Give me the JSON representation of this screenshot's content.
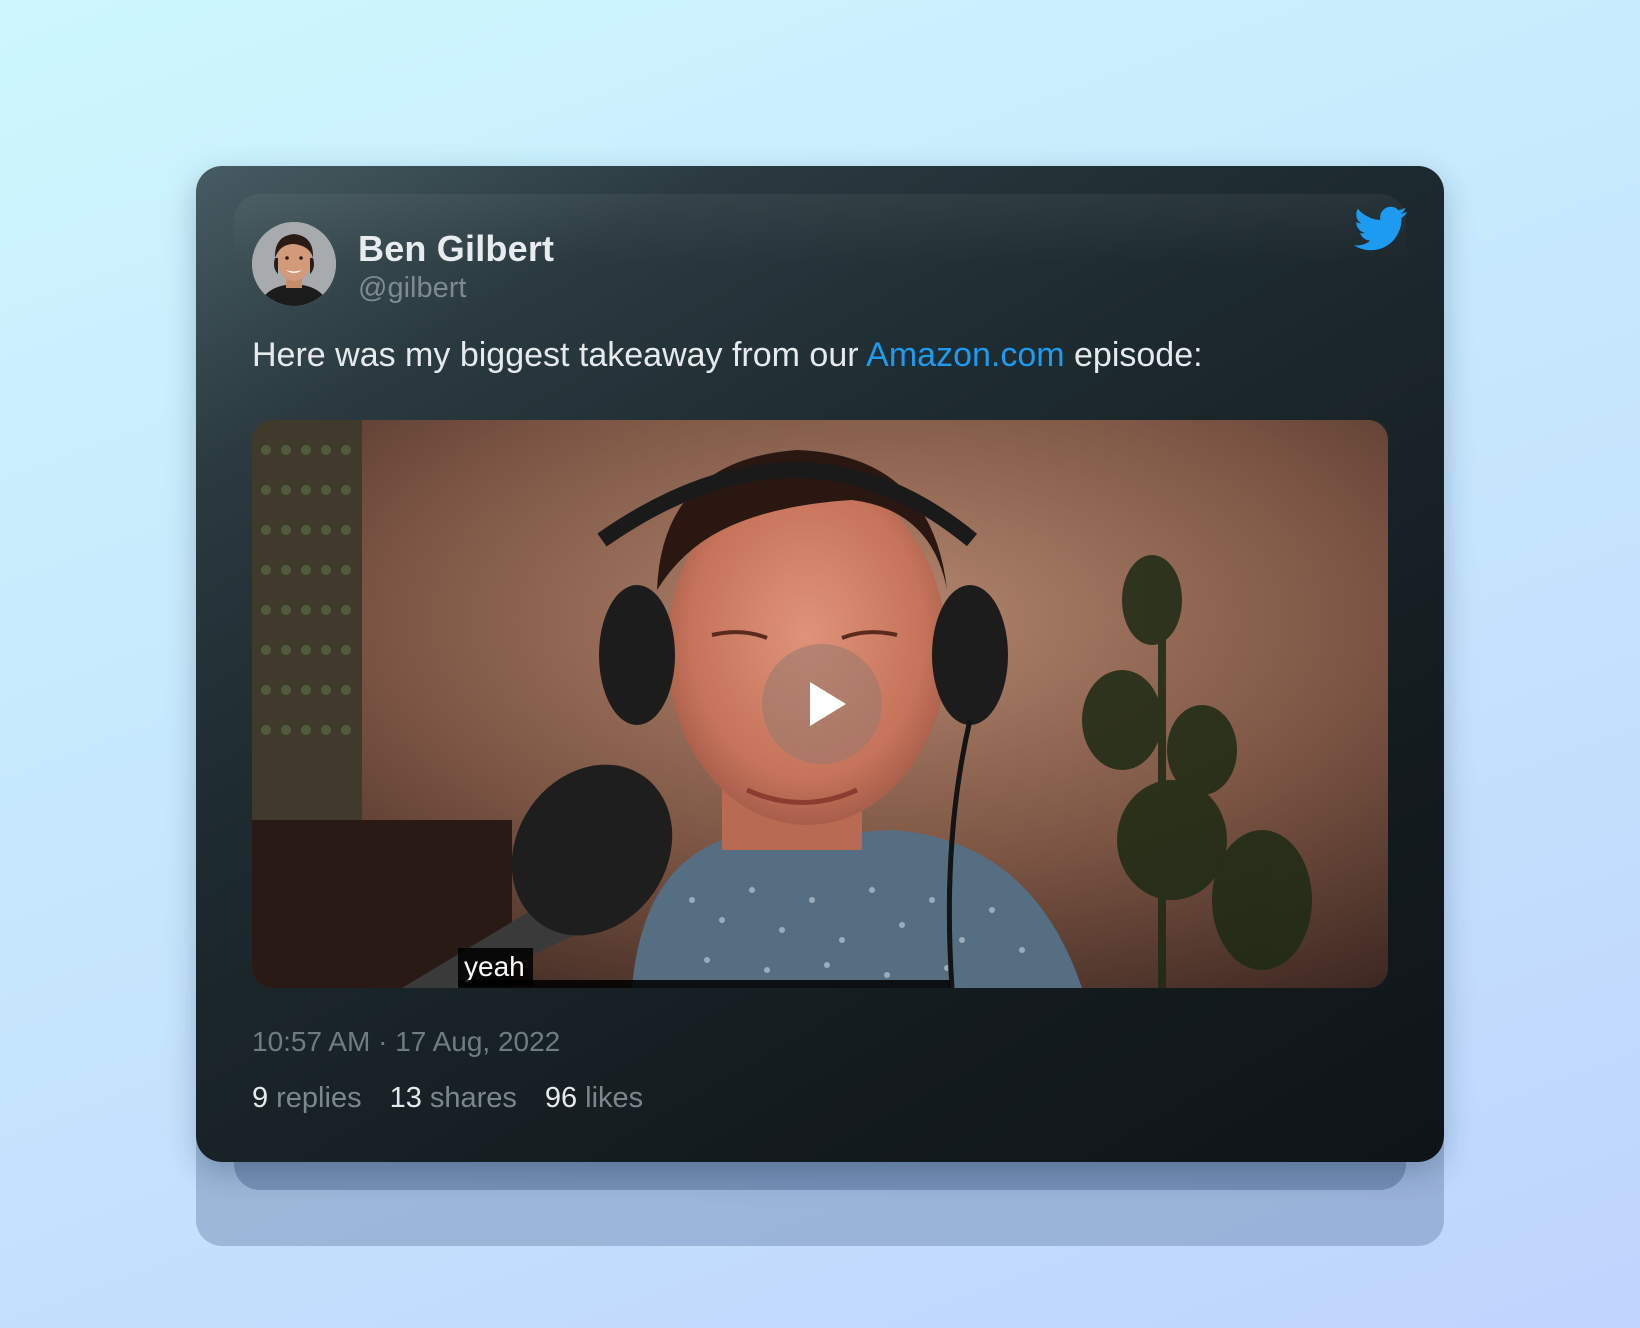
{
  "tweet": {
    "author_name": "Ben Gilbert",
    "author_handle": "@gilbert",
    "text_before": "Here was my biggest takeaway from our ",
    "link_text": "Amazon.com",
    "text_after": " episode:",
    "timestamp": "10:57 AM · 17 Aug, 2022",
    "caption": "yeah",
    "stats": {
      "replies_count": "9",
      "replies_label": "replies",
      "shares_count": "13",
      "shares_label": "shares",
      "likes_count": "96",
      "likes_label": "likes"
    }
  },
  "icons": {
    "brand": "twitter-bird-icon",
    "play": "play-icon"
  },
  "colors": {
    "link": "#1d9bf0",
    "twitter_brand": "#1d9bf0"
  }
}
